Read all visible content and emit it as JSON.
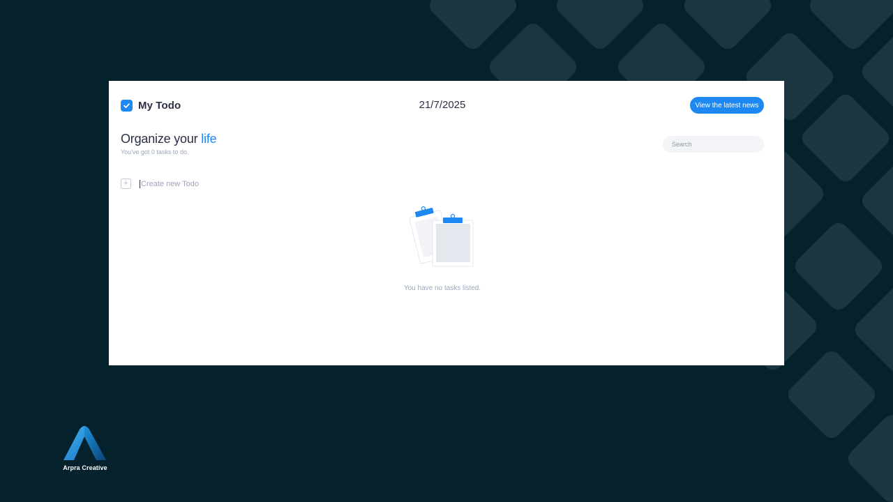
{
  "header": {
    "app_title": "My Todo",
    "date": "21/7/2025",
    "news_button": "View the latest news"
  },
  "intro": {
    "heading_prefix": "Organize your",
    "heading_accent": "life",
    "subheading": "You've got 0 tasks to do."
  },
  "search": {
    "placeholder": "Search",
    "value": ""
  },
  "create": {
    "placeholder": "Create new Todo",
    "value": ""
  },
  "empty_state": {
    "message": "You have no tasks listed.",
    "illustration": "clipboard-icon"
  },
  "branding": {
    "company_name": "Arpra Creative",
    "logo": "arpra-logo-icon"
  },
  "icons": {
    "brand_check": "checkbox-checked-icon",
    "add": "plus-icon"
  },
  "colors": {
    "accent": "#1e88f2",
    "background": "#04212c",
    "card": "#ffffff",
    "text_primary": "#2a2f45",
    "text_muted": "#9aa5b8"
  }
}
